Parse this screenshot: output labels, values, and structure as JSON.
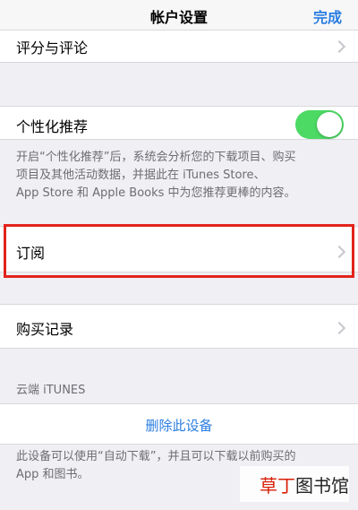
{
  "nav": {
    "title": "帐户设置",
    "done": "完成"
  },
  "rows": {
    "rating": "评分与评论",
    "personalization": "个性化推荐",
    "subscriptions": "订阅",
    "purchase_history": "购买记录"
  },
  "personalization": {
    "toggle_on": true,
    "footer_line1": "开启“个性化推荐”后，系统会分析您的下载项目、购买",
    "footer_line2": "项目及其他活动数据，并据此在 iTunes Store、",
    "footer_line3": "App Store 和 Apple Books 中为您推荐更棒的内容。"
  },
  "cloud_section": {
    "header": "云端 iTUNES",
    "remove_device": "删除此设备",
    "footer_line1": "此设备可以使用“自动下载”，并且可以下载以前购买的",
    "footer_line2": "App 和图书。"
  },
  "watermark": {
    "part1": "草丁",
    "part2": "图书馆"
  },
  "colors": {
    "accent": "#2a7de1",
    "toggle_on": "#4cd964",
    "highlight": "#e2231a",
    "background": "#efeff4"
  }
}
